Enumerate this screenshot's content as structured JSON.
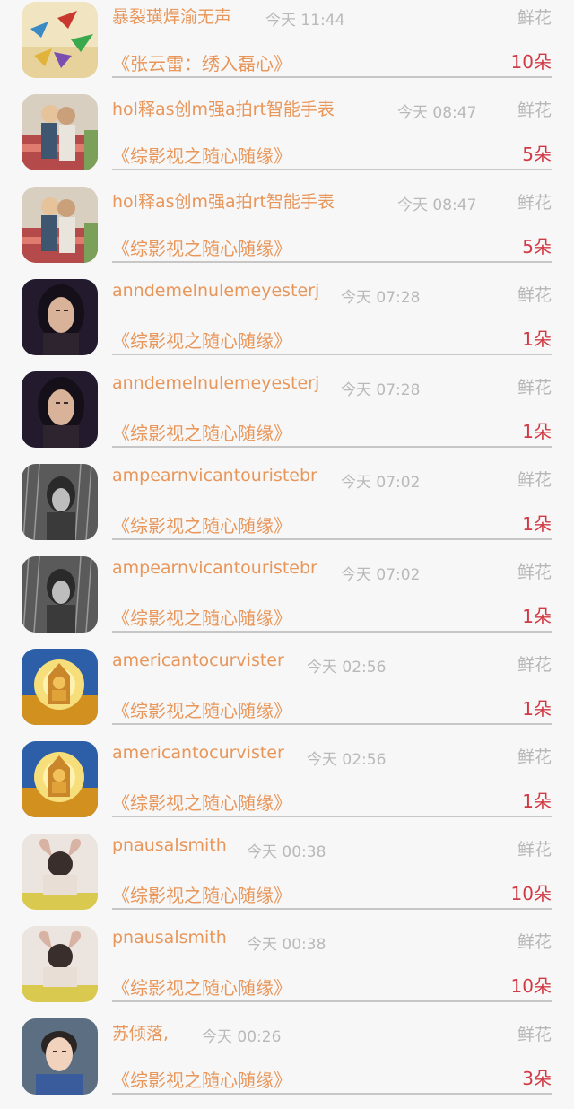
{
  "gift_records": [
    {
      "name": "暴裂璜焊渝无声",
      "time": "今天 11:44",
      "gift_type": "鲜花",
      "work": "《张云雷：绣入磊心》",
      "count": "10朵",
      "avatar_icon": "paper-cranes-avatar-icon"
    },
    {
      "name": "hol释as创m强a拍rt智能手表",
      "time": "今天 08:47",
      "gift_type": "鲜花",
      "work": "《综影视之随心随缘》",
      "count": "5朵",
      "avatar_icon": "couple-photo-avatar-icon"
    },
    {
      "name": "hol释as创m强a拍rt智能手表",
      "time": "今天 08:47",
      "gift_type": "鲜花",
      "work": "《综影视之随心随缘》",
      "count": "5朵",
      "avatar_icon": "couple-photo-avatar-icon"
    },
    {
      "name": "anndemelnulemeyesterj",
      "time": "今天 07:28",
      "gift_type": "鲜花",
      "work": "《综影视之随心随缘》",
      "count": "1朵",
      "avatar_icon": "woman-portrait-avatar-icon"
    },
    {
      "name": "anndemelnulemeyesterj",
      "time": "今天 07:28",
      "gift_type": "鲜花",
      "work": "《综影视之随心随缘》",
      "count": "1朵",
      "avatar_icon": "woman-portrait-avatar-icon"
    },
    {
      "name": "ampearnvicantouristebr",
      "time": "今天 07:02",
      "gift_type": "鲜花",
      "work": "《综影视之随心随缘》",
      "count": "1朵",
      "avatar_icon": "rain-figure-avatar-icon"
    },
    {
      "name": "ampearnvicantouristebr",
      "time": "今天 07:02",
      "gift_type": "鲜花",
      "work": "《综影视之随心随缘》",
      "count": "1朵",
      "avatar_icon": "rain-figure-avatar-icon"
    },
    {
      "name": "americantocurvister",
      "time": "今天 02:56",
      "gift_type": "鲜花",
      "work": "《综影视之随心随缘》",
      "count": "1朵",
      "avatar_icon": "golden-buddha-avatar-icon"
    },
    {
      "name": "americantocurvister",
      "time": "今天 02:56",
      "gift_type": "鲜花",
      "work": "《综影视之随心随缘》",
      "count": "1朵",
      "avatar_icon": "golden-buddha-avatar-icon"
    },
    {
      "name": "pnausalsmith",
      "time": "今天 00:38",
      "gift_type": "鲜花",
      "work": "《综影视之随心随缘》",
      "count": "10朵",
      "avatar_icon": "heart-hands-girl-avatar-icon"
    },
    {
      "name": "pnausalsmith",
      "time": "今天 00:38",
      "gift_type": "鲜花",
      "work": "《综影视之随心随缘》",
      "count": "10朵",
      "avatar_icon": "heart-hands-girl-avatar-icon"
    },
    {
      "name": "苏倾落,",
      "time": "今天 00:26",
      "gift_type": "鲜花",
      "work": "《综影视之随心随缘》",
      "count": "3朵",
      "avatar_icon": "young-man-avatar-icon"
    }
  ],
  "colors": {
    "background": "#f7f7f7",
    "name_and_work": "#e8965a",
    "time_and_gift_type": "#b9b9b9",
    "count": "#d13a44",
    "divider": "#c7c7c7"
  }
}
